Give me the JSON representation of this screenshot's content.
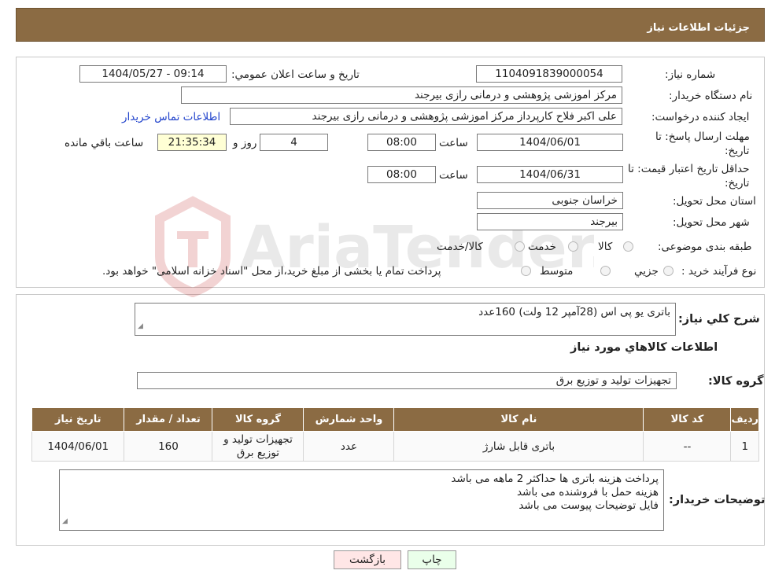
{
  "header": {
    "title": "جزئیات اطلاعات نیاز"
  },
  "fields": {
    "need_number_label": "شماره نیاز:",
    "need_number": "1104091839000054",
    "announce_label": "تاریخ و ساعت اعلان عمومي:",
    "announce_value": "1404/05/27 - 09:14",
    "buyer_label": "نام دستگاه خریدار:",
    "buyer_value": "مرکز اموزشی پژوهشی و درمانی رازی بیرجند",
    "creator_label": "ایجاد کننده درخواست:",
    "creator_value": "علی اکبر فلاح کارپرداز مرکز اموزشی پژوهشی و درمانی رازی بیرجند",
    "contact_link": "اطلاعات تماس خریدار",
    "deadline_label_1": "مهلت ارسال پاسخ: تا",
    "deadline_label_2": "تاریخ:",
    "deadline_date": "1404/06/01",
    "time_label": "ساعت",
    "deadline_time": "08:00",
    "days_value": "4",
    "days_label": "روز و",
    "remaining_time": "21:35:34",
    "remaining_label": "ساعت باقي مانده",
    "validity_label_1": "حداقل تاریخ اعتبار قیمت: تا",
    "validity_label_2": "تاریخ:",
    "validity_date": "1404/06/31",
    "validity_time": "08:00",
    "province_label": "استان محل تحویل:",
    "province_value": "خراسان جنوبی",
    "city_label": "شهر محل تحویل:",
    "city_value": "بیرجند",
    "category_label": "طبقه بندی موضوعی:",
    "category_options": [
      "کالا",
      "خدمت",
      "کالا/خدمت"
    ],
    "process_label": "نوع فرآیند خرید :",
    "process_options": [
      "جزیي",
      "متوسط"
    ],
    "process_note": "پرداخت تمام یا بخشی از مبلغ خرید،از محل \"اسناد خزانه اسلامی\" خواهد بود."
  },
  "summary": {
    "label": "شرح کلي نیاز:",
    "value": "باتری یو پی اس (28آمپر 12 ولت) 160عدد",
    "goods_info_title": "اطلاعات کالاهاي مورد نیاز",
    "group_label": "گروه کالا:",
    "group_value": "تجهیزات تولید و توزیع برق"
  },
  "table": {
    "headers": [
      "ردیف",
      "کد کالا",
      "نام کالا",
      "واحد شمارش",
      "گروه کالا",
      "تعداد / مقدار",
      "تاریخ نیاز"
    ],
    "rows": [
      [
        "1",
        "--",
        "باتری قابل شارژ",
        "عدد",
        "تجهیزات تولید و توزیع برق",
        "160",
        "1404/06/01"
      ]
    ]
  },
  "notes": {
    "label": "توضیحات خریدار:",
    "lines": [
      "پرداخت هزینه باتری ها حداکثر 2 ماهه می باشد",
      "هزینه حمل با فروشنده می باشد",
      "فایل توضیحات پیوست می باشد"
    ]
  },
  "buttons": {
    "print": "چاپ",
    "back": "بازگشت"
  },
  "watermark": "AriaTender.neT",
  "colors": {
    "header_bg": "#8b6b43",
    "link": "#2244cc",
    "timer_bg": "#ffffd5",
    "print_bg": "#eaffea",
    "back_bg": "#ffe6e6"
  }
}
